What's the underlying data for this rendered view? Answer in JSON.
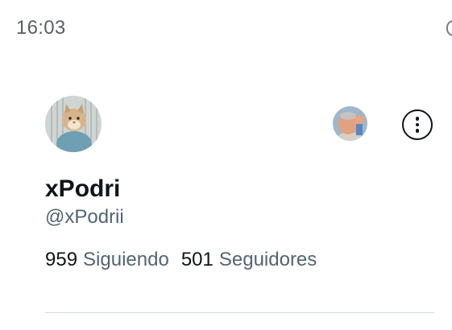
{
  "status_bar": {
    "time": "16:03"
  },
  "profile": {
    "display_name": "xPodri",
    "handle": "@xPodrii",
    "following_count": "959",
    "following_label": "Siguiendo",
    "followers_count": "501",
    "followers_label": "Seguidores"
  },
  "icons": {
    "avatar": "cat-photo-avatar",
    "account_switch": "other-account-avatar",
    "more": "more-options-icon"
  },
  "colors": {
    "primary_text": "#0f1419",
    "secondary_text": "#536471",
    "divider": "#cfd9de"
  }
}
